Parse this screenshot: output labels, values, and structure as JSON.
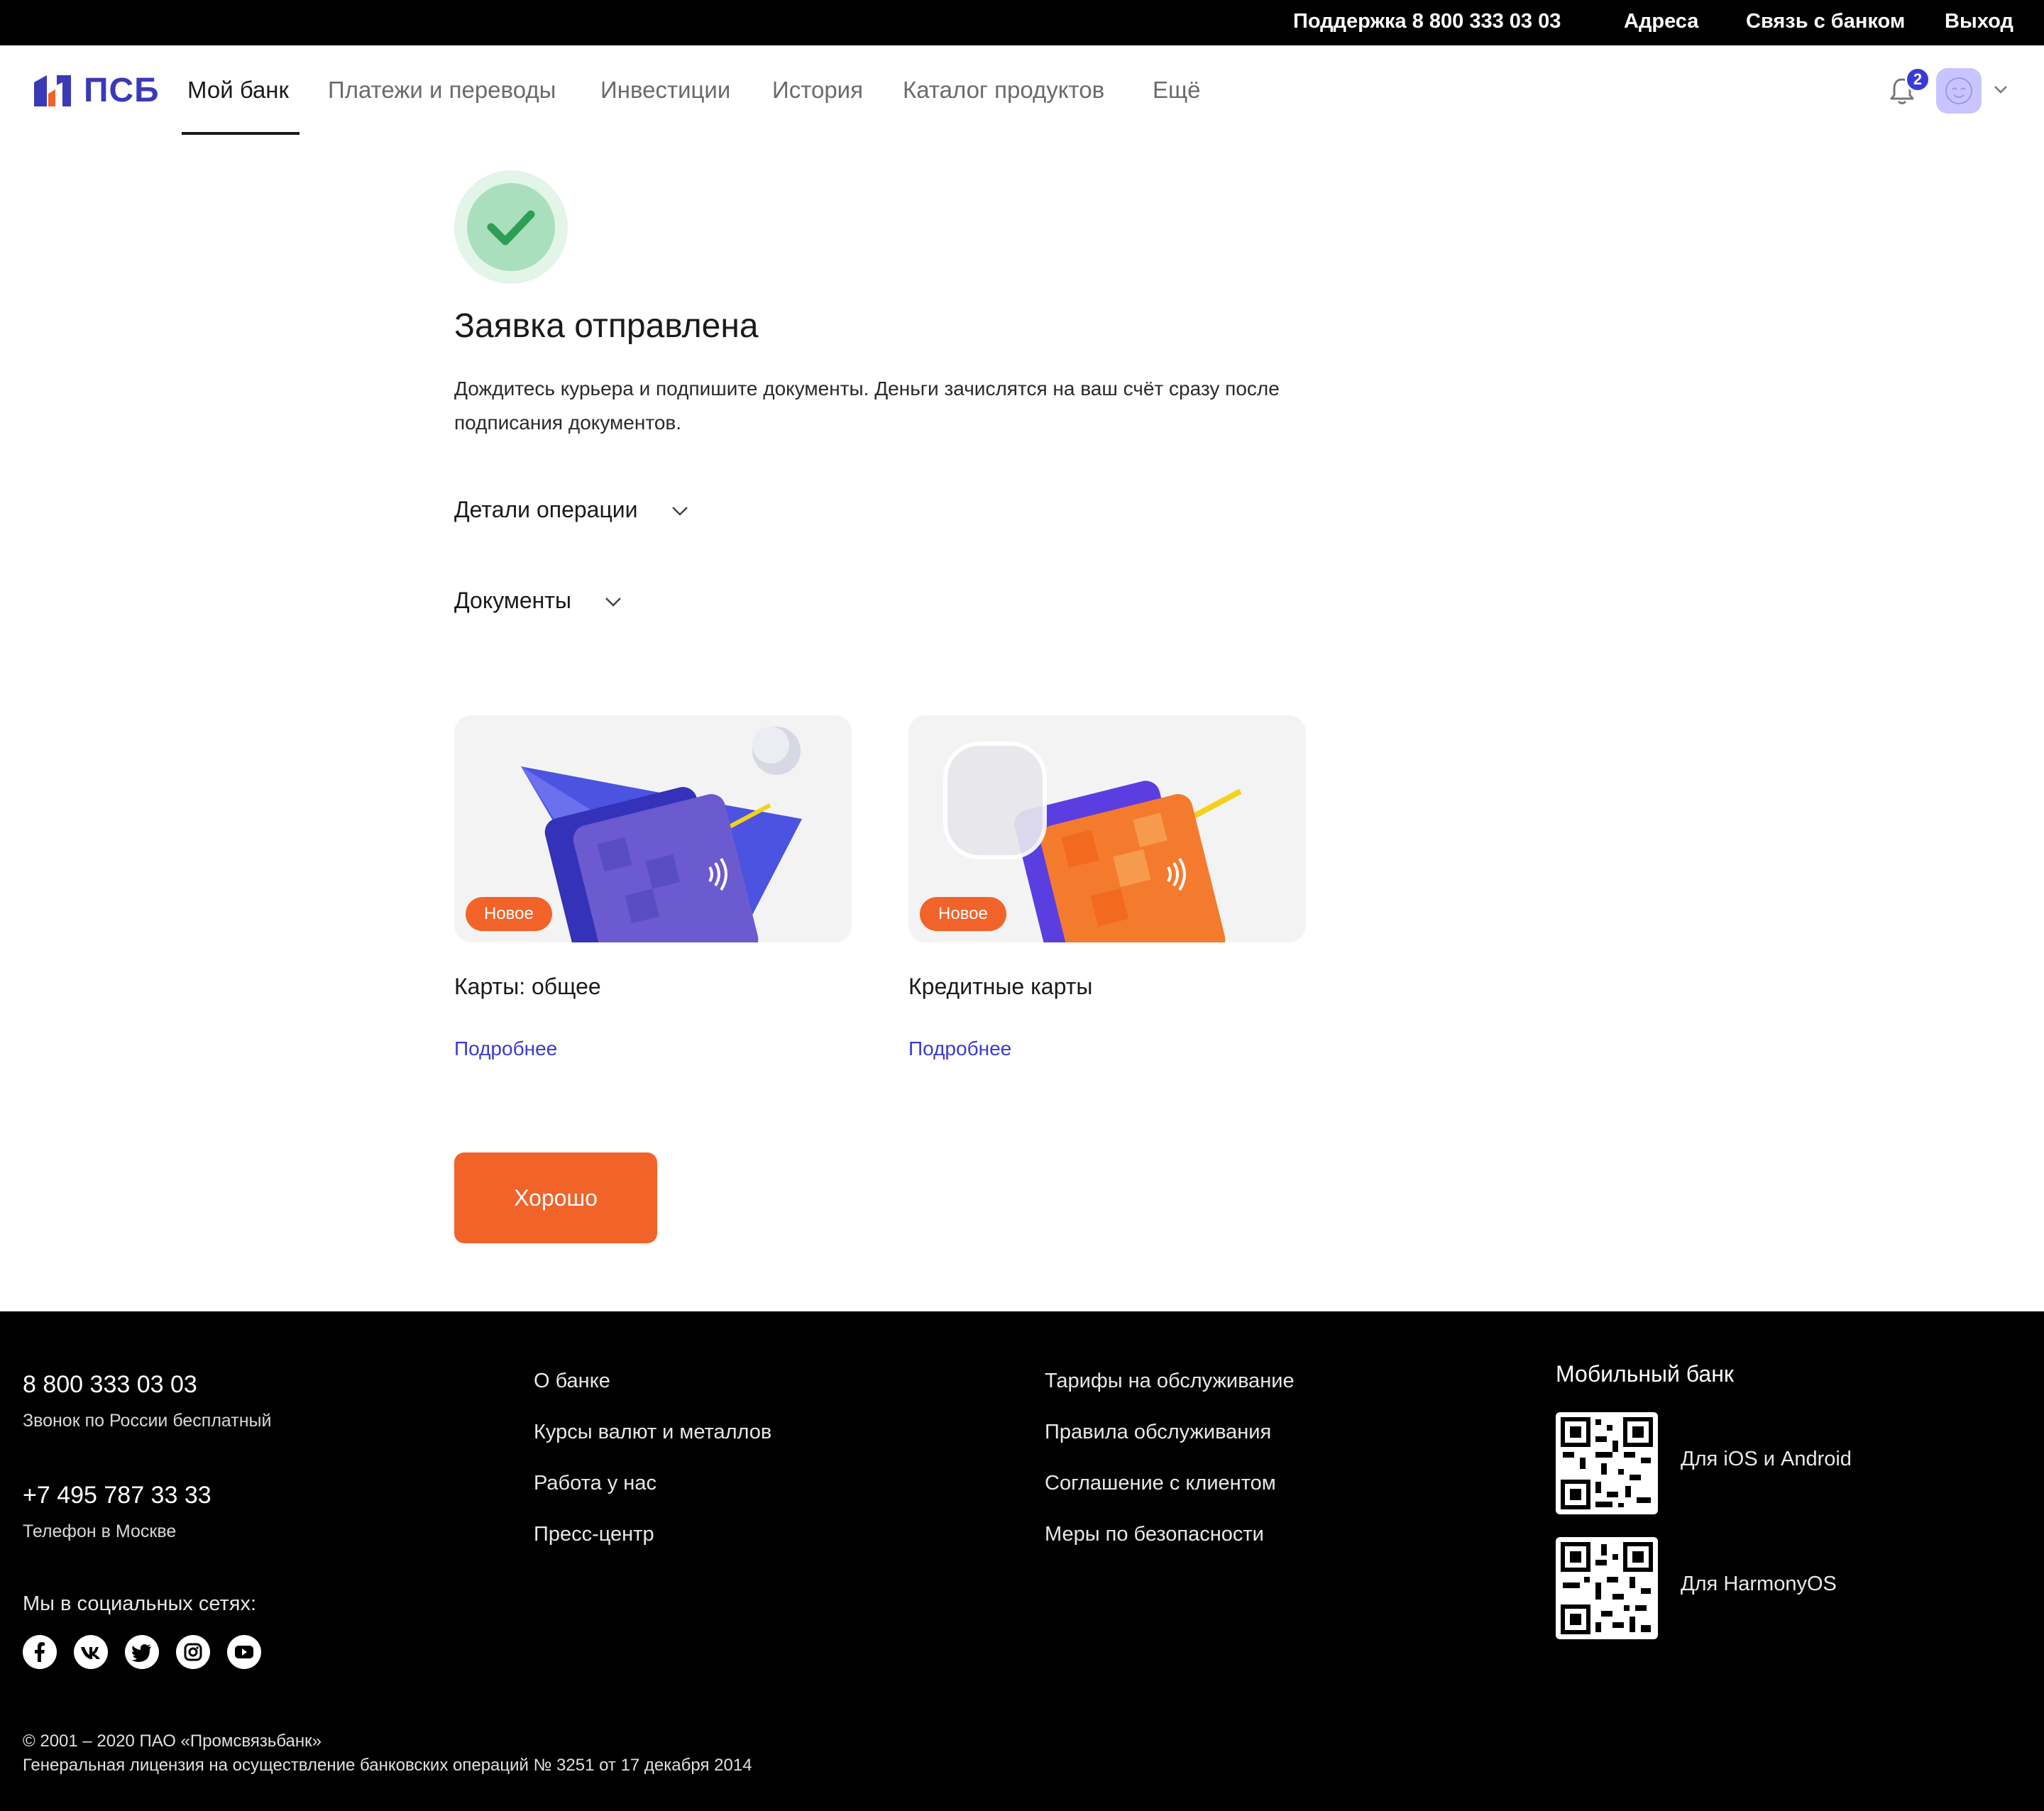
{
  "topbar": {
    "support": "Поддержка 8 800 333 03 03",
    "addresses": "Адреса",
    "contact": "Связь с банком",
    "logout": "Выход"
  },
  "header": {
    "brand": "ПСБ",
    "nav": [
      "Мой банк",
      "Платежи и переводы",
      "Инвестиции",
      "История",
      "Каталог продуктов",
      "Ещё"
    ],
    "active_nav": "Мой банк",
    "notifications_count": "2"
  },
  "main": {
    "title": "Заявка отправлена",
    "description": "Дождитесь курьера и подпишите документы. Деньги зачислятся на ваш счёт сразу после подписания документов.",
    "accordions": [
      "Детали операции",
      "Документы"
    ],
    "cards": [
      {
        "badge": "Новое",
        "title": "Карты: общее",
        "link": "Подробнее"
      },
      {
        "badge": "Новое",
        "title": "Кредитные карты",
        "link": "Подробнее"
      }
    ],
    "ok_button": "Хорошо"
  },
  "footer": {
    "phones": [
      {
        "number": "8 800 333 03 03",
        "note": "Звонок по России бесплатный"
      },
      {
        "number": "+7 495 787 33 33",
        "note": "Телефон в Москве"
      }
    ],
    "social_label": "Мы в социальных сетях:",
    "social_icons": [
      "facebook-icon",
      "vk-icon",
      "twitter-icon",
      "instagram-icon",
      "youtube-icon"
    ],
    "col1": [
      "О банке",
      "Курсы валют и металлов",
      "Работа у нас",
      "Пресс-центр"
    ],
    "col2": [
      "Тарифы на обслуживание",
      "Правила обслуживания",
      "Соглашение с клиентом",
      "Меры по безопасности"
    ],
    "mobile": {
      "title": "Мобильный банк",
      "apps": [
        "Для iOS и Android",
        "Для HarmonyOS"
      ]
    },
    "copyright": "© 2001 – 2020 ПАО «Промсвязьбанк»",
    "license": "Генеральная лицензия на осуществление банковских операций № 3251 от 17 декабря 2014"
  },
  "colors": {
    "accent": "#f2632a",
    "brand": "#3a3ab8",
    "link": "#3a3ad0",
    "success": "#2e9e55"
  }
}
